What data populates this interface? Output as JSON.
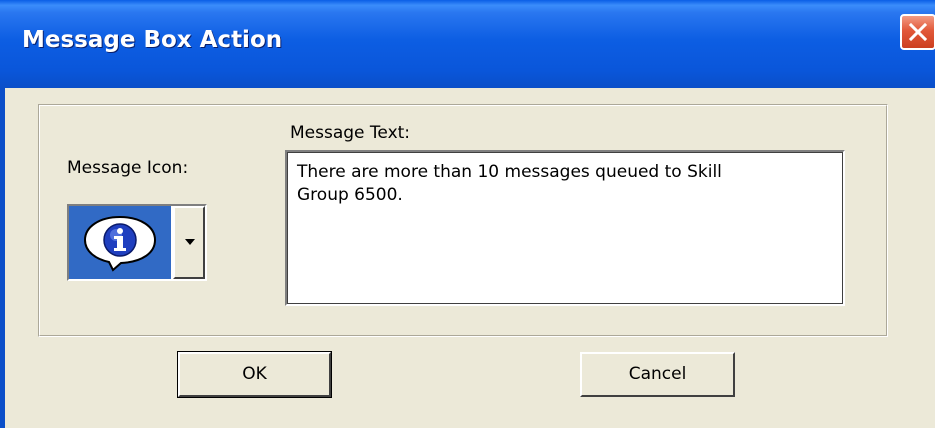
{
  "window": {
    "title": "Message Box Action",
    "close_icon": "close-icon",
    "accent": "#0b4fc9"
  },
  "form": {
    "message_icon_label": "Message Icon:",
    "message_icon_selected": "info-icon",
    "message_text_label": "Message Text:",
    "message_text_value": "There are more than 10 messages queued to Skill Group 6500."
  },
  "buttons": {
    "ok_label": "OK",
    "cancel_label": "Cancel"
  }
}
